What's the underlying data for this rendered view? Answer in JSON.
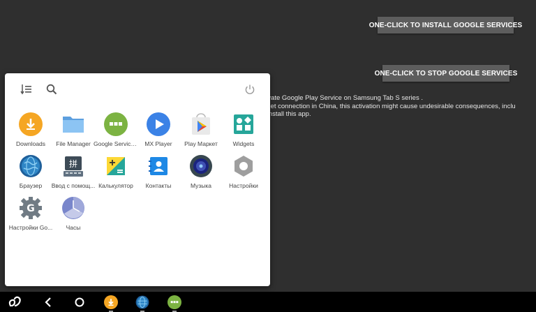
{
  "background": {
    "install_button": "ONE-CLICK TO INSTALL GOOGLE SERVICES",
    "stop_button": "ONE-CLICK TO STOP GOOGLE SERVICES",
    "text_lines": [
      "sed to activate Google Play Service on Samsung Tab S series .",
      "e the internet connection in China, this activation might cause undesirable consequences, inclu",
      "wn risk to install this app."
    ]
  },
  "launcher": {
    "apps": [
      {
        "label": "Downloads",
        "icon": "download-icon"
      },
      {
        "label": "File Manager",
        "icon": "folder-icon"
      },
      {
        "label": "Google Service...",
        "icon": "google-services-icon"
      },
      {
        "label": "MX Player",
        "icon": "play-icon"
      },
      {
        "label": "Play Маркет",
        "icon": "play-store-icon"
      },
      {
        "label": "Widgets",
        "icon": "widgets-icon"
      },
      {
        "label": "Браузер",
        "icon": "globe-icon"
      },
      {
        "label": "Ввод с помощ...",
        "icon": "keyboard-icon"
      },
      {
        "label": "Калькулятор",
        "icon": "calculator-icon"
      },
      {
        "label": "Контакты",
        "icon": "contacts-icon"
      },
      {
        "label": "Музыка",
        "icon": "music-icon"
      },
      {
        "label": "Настройки",
        "icon": "settings-gear-icon"
      },
      {
        "label": "Настройки Go...",
        "icon": "google-settings-icon"
      },
      {
        "label": "Часы",
        "icon": "clock-icon"
      }
    ]
  },
  "colors": {
    "download": "#f5a623",
    "folder": "#6aaee9",
    "google_services": "#7cb342",
    "mx_player": "#3b82e6",
    "widgets": "#26a69a",
    "background": "#2f2f2f",
    "navbar": "#000000"
  }
}
